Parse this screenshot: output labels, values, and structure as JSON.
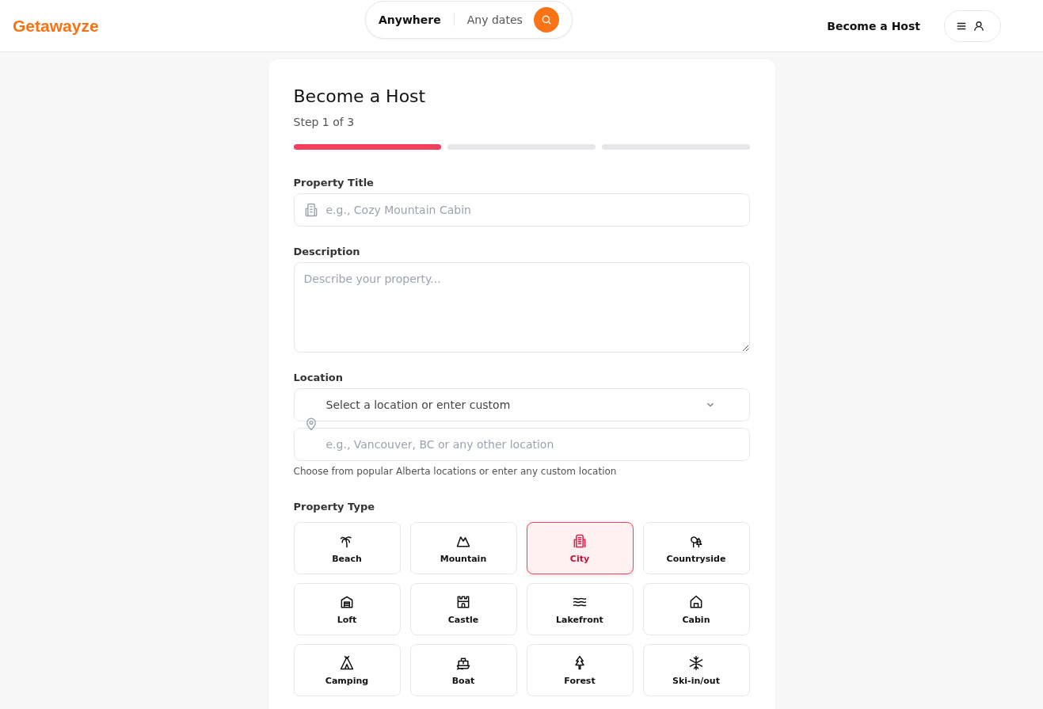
{
  "header": {
    "logo": "Getawayze",
    "search": {
      "location": "Anywhere",
      "dates": "Any dates"
    },
    "host_link": "Become a Host"
  },
  "form": {
    "title": "Become a Host",
    "step": "Step 1 of 3",
    "steps": [
      {
        "done": true
      },
      {
        "done": false
      },
      {
        "done": false
      }
    ],
    "property_title": {
      "label": "Property Title",
      "placeholder": "e.g., Cozy Mountain Cabin"
    },
    "description": {
      "label": "Description",
      "placeholder": "Describe your property..."
    },
    "location": {
      "label": "Location",
      "select_placeholder": "Select a location or enter custom",
      "custom_placeholder": "e.g., Vancouver, BC or any other location",
      "hint": "Choose from popular Alberta locations or enter any custom location"
    },
    "property_type": {
      "label": "Property Type",
      "options": [
        {
          "label": "Beach",
          "selected": false
        },
        {
          "label": "Mountain",
          "selected": false
        },
        {
          "label": "City",
          "selected": true
        },
        {
          "label": "Countryside",
          "selected": false
        },
        {
          "label": "Loft",
          "selected": false
        },
        {
          "label": "Castle",
          "selected": false
        },
        {
          "label": "Lakefront",
          "selected": false
        },
        {
          "label": "Cabin",
          "selected": false
        },
        {
          "label": "Camping",
          "selected": false
        },
        {
          "label": "Boat",
          "selected": false
        },
        {
          "label": "Forest",
          "selected": false
        },
        {
          "label": "Ski-in/out",
          "selected": false
        }
      ]
    }
  }
}
